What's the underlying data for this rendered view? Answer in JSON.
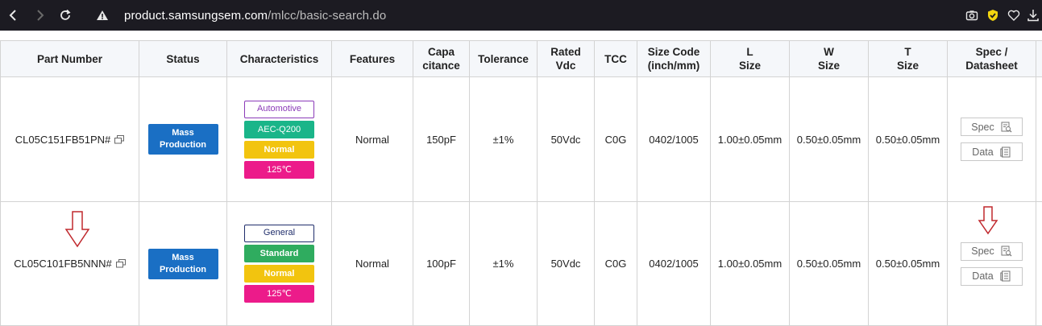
{
  "browser": {
    "url_host": "product.samsungsem.com",
    "url_path": "/mlcc/basic-search.do"
  },
  "table": {
    "headers": [
      [
        "Part Number"
      ],
      [
        "Status"
      ],
      [
        "Characteristics"
      ],
      [
        "Features"
      ],
      [
        "Capa",
        "citance"
      ],
      [
        "Tolerance"
      ],
      [
        "Rated",
        "Vdc"
      ],
      [
        "TCC"
      ],
      [
        "Size Code",
        "(inch/mm)"
      ],
      [
        "L",
        "Size"
      ],
      [
        "W",
        "Size"
      ],
      [
        "T",
        "Size"
      ],
      [
        "Spec /",
        "Datasheet"
      ]
    ],
    "rows": [
      {
        "part_number": "CL05C151FB51PN#",
        "status": [
          "Mass",
          "Production"
        ],
        "characteristics": [
          "Automotive",
          "AEC-Q200",
          "Normal",
          "125℃"
        ],
        "features": "Normal",
        "capacitance": "150pF",
        "tolerance": "±1%",
        "rated_vdc": "50Vdc",
        "tcc": "C0G",
        "size_code": "0402/1005",
        "l_size": "1.00±0.05mm",
        "w_size": "0.50±0.05mm",
        "t_size": "0.50±0.05mm",
        "spec_label": "Spec",
        "data_label": "Data"
      },
      {
        "part_number": "CL05C101FB5NNN#",
        "status": [
          "Mass",
          "Production"
        ],
        "characteristics": [
          "General",
          "Standard",
          "Normal",
          "125℃"
        ],
        "features": "Normal",
        "capacitance": "100pF",
        "tolerance": "±1%",
        "rated_vdc": "50Vdc",
        "tcc": "C0G",
        "size_code": "0402/1005",
        "l_size": "1.00±0.05mm",
        "w_size": "0.50±0.05mm",
        "t_size": "0.50±0.05mm",
        "spec_label": "Spec",
        "data_label": "Data"
      }
    ]
  },
  "colors": {
    "status_blue": "#1a6fc4",
    "automotive_purple": "#8b3ab8",
    "general_navy": "#1f2d6b",
    "aec_green": "#1ab589",
    "standard_green": "#2fac5f",
    "normal_yellow": "#f2c40f",
    "temp_pink": "#ec1b8a",
    "annotation_red": "#c0282d"
  }
}
